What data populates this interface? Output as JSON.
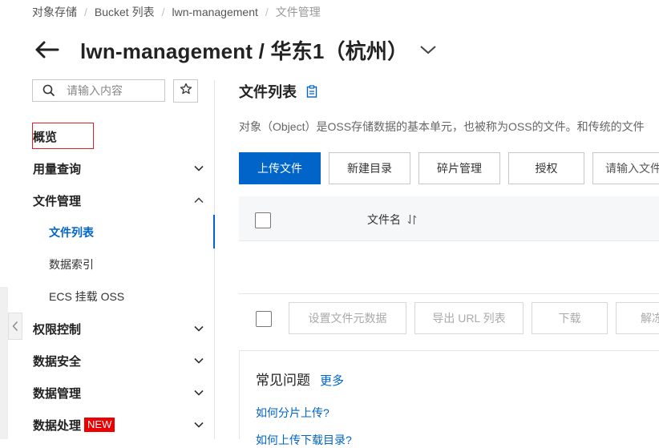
{
  "breadcrumb": [
    "对象存储",
    "Bucket 列表",
    "lwn-management",
    "文件管理"
  ],
  "header": {
    "title": "lwn-management / 华东1（杭州）"
  },
  "sidebar": {
    "search_placeholder": "请输入内容",
    "overview": "概览",
    "items": [
      {
        "label": "用量查询"
      },
      {
        "label": "文件管理"
      },
      {
        "label": "文件列表"
      },
      {
        "label": "数据索引"
      },
      {
        "label": "ECS 挂载 OSS"
      },
      {
        "label": "权限控制"
      },
      {
        "label": "数据安全"
      },
      {
        "label": "数据管理"
      },
      {
        "label": "数据处理",
        "badge": "NEW"
      }
    ]
  },
  "main": {
    "title": "文件列表",
    "description": "对象（Object）是OSS存储数据的基本单元，也被称为OSS的文件。和传统的文件",
    "toolbar": {
      "upload": "上传文件",
      "new_dir": "新建目录",
      "fragments": "碎片管理",
      "authorize": "授权",
      "search_placeholder": "请输入文件"
    },
    "table": {
      "column_name": "文件名"
    },
    "bulk": {
      "set_meta": "设置文件元数据",
      "export_url": "导出 URL 列表",
      "download": "下载",
      "unfreeze": "解冻"
    },
    "faq": {
      "title": "常见问题",
      "more": "更多",
      "links": [
        "如何分片上传?",
        "如何上传下载目录?"
      ]
    }
  },
  "colors": {
    "primary": "#0064c8",
    "highlight_box": "#e02020",
    "badge": "#ee0000"
  }
}
